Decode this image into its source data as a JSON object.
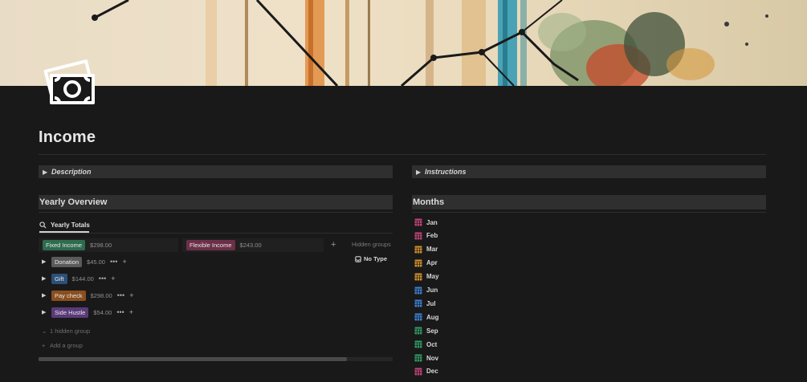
{
  "page": {
    "title": "Income"
  },
  "toggles": {
    "description": "Description",
    "instructions": "Instructions"
  },
  "sections": {
    "yearly_overview": "Yearly Overview",
    "months": "Months"
  },
  "view": {
    "tab_label": "Yearly Totals",
    "tab_icon": "search-icon"
  },
  "board": {
    "columns": [
      {
        "tag": "Fixed Income",
        "amount": "$298.00",
        "color": "#2e6b4f"
      },
      {
        "tag": "Flexible Income",
        "amount": "$243.00",
        "color": "#6b2f48"
      }
    ],
    "hidden_groups_label": "Hidden groups",
    "no_type_label": "No Type",
    "groups": [
      {
        "tag": "Donation",
        "amount": "$45.00",
        "color": "#5a5a5a"
      },
      {
        "tag": "Gift",
        "amount": "$144.00",
        "color": "#2c4f78"
      },
      {
        "tag": "Pay check",
        "amount": "$298.00",
        "color": "#8a4e1f"
      },
      {
        "tag": "Side Hustle",
        "amount": "$54.00",
        "color": "#5a3a78"
      }
    ],
    "hidden_group_label": "1 hidden group",
    "add_group_label": "Add a group"
  },
  "months": [
    {
      "name": "Jan",
      "color": "#c0427a"
    },
    {
      "name": "Feb",
      "color": "#c0427a"
    },
    {
      "name": "Mar",
      "color": "#d0902a"
    },
    {
      "name": "Apr",
      "color": "#d0902a"
    },
    {
      "name": "May",
      "color": "#d0902a"
    },
    {
      "name": "Jun",
      "color": "#3c7fd0"
    },
    {
      "name": "Jul",
      "color": "#3c7fd0"
    },
    {
      "name": "Aug",
      "color": "#3c7fd0"
    },
    {
      "name": "Sep",
      "color": "#2f9a62"
    },
    {
      "name": "Oct",
      "color": "#2f9a62"
    },
    {
      "name": "Nov",
      "color": "#2f9a62"
    },
    {
      "name": "Dec",
      "color": "#c0427a"
    }
  ],
  "icons": {
    "page_icon": "money-icon",
    "month_icon": "calendar-icon"
  }
}
